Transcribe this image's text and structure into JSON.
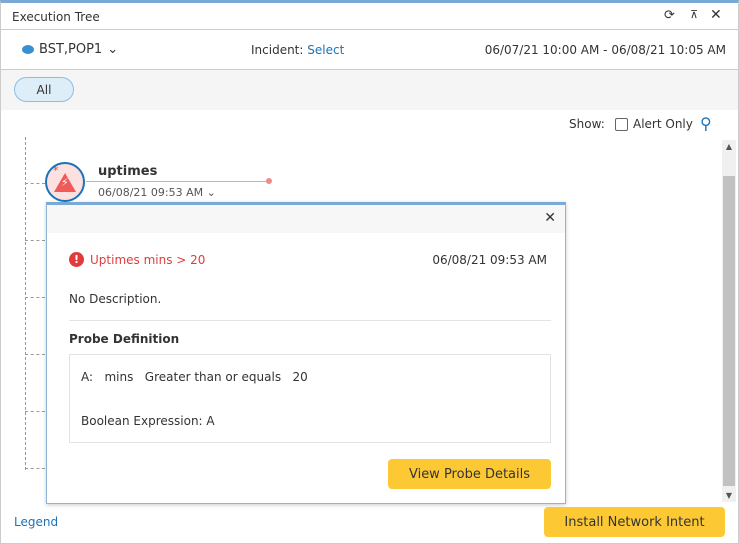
{
  "window": {
    "title": "Execution Tree"
  },
  "toolbar": {
    "device": "BST,POP1",
    "incident_label": "Incident:",
    "incident_link": "Select",
    "time_range": "06/07/21 10:00 AM - 06/08/21 10:05 AM"
  },
  "filter": {
    "all_label": "All"
  },
  "show": {
    "label": "Show:",
    "alert_only": "Alert Only",
    "alert_only_checked": false
  },
  "node": {
    "name": "uptimes",
    "time": "06/08/21 09:53 AM"
  },
  "popup": {
    "alert_text": "Uptimes mins > 20",
    "alert_time": "06/08/21 09:53 AM",
    "description": "No Description.",
    "section_title": "Probe Definition",
    "probe_line": "A:   mins   Greater than or equals   20",
    "boolean_expression": "Boolean Expression: A",
    "button": "View Probe Details"
  },
  "footer": {
    "legend": "Legend",
    "install_button": "Install Network Intent"
  },
  "colors": {
    "accent": "#1a73b8",
    "alert": "#e03c3c",
    "button": "#fcc935"
  }
}
